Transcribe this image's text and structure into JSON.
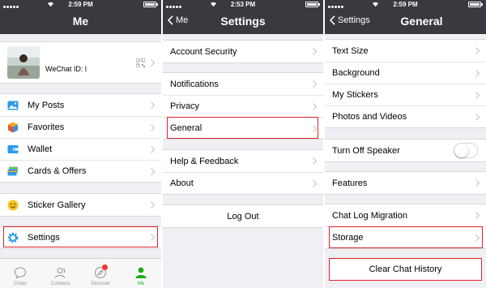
{
  "screens": [
    {
      "status_time": "2:59 PM",
      "nav_title": "Me",
      "profile": {
        "wechat_id": "WeChat ID: l"
      },
      "groups": [
        [
          {
            "label": "My Posts",
            "icon": "photo-icon"
          },
          {
            "label": "Favorites",
            "icon": "cube-icon"
          },
          {
            "label": "Wallet",
            "icon": "wallet-icon"
          },
          {
            "label": "Cards & Offers",
            "icon": "cards-icon"
          }
        ],
        [
          {
            "label": "Sticker Gallery",
            "icon": "smiley-icon"
          }
        ],
        [
          {
            "label": "Settings",
            "icon": "gear-icon",
            "highlighted": true
          }
        ]
      ],
      "tabbar": [
        {
          "label": "Chats",
          "icon": "chat-bubble-icon"
        },
        {
          "label": "Contacts",
          "icon": "contacts-icon"
        },
        {
          "label": "Discover",
          "icon": "compass-icon",
          "badge": true
        },
        {
          "label": "Me",
          "icon": "person-icon",
          "active": true
        }
      ]
    },
    {
      "status_time": "2:53 PM",
      "nav_title": "Settings",
      "back_label": "Me",
      "groups": [
        [
          {
            "label": "Account Security"
          }
        ],
        [
          {
            "label": "Notifications"
          },
          {
            "label": "Privacy"
          },
          {
            "label": "General",
            "highlighted": true
          }
        ],
        [
          {
            "label": "Help & Feedback"
          },
          {
            "label": "About"
          }
        ]
      ],
      "logout_label": "Log Out"
    },
    {
      "status_time": "2:59 PM",
      "nav_title": "General",
      "back_label": "Settings",
      "groups": [
        [
          {
            "label": "Text Size"
          },
          {
            "label": "Background"
          },
          {
            "label": "My Stickers"
          },
          {
            "label": "Photos and Videos"
          }
        ],
        [
          {
            "label": "Turn Off Speaker",
            "toggle": false
          }
        ],
        [
          {
            "label": "Features"
          }
        ],
        [
          {
            "label": "Chat Log Migration"
          },
          {
            "label": "Storage",
            "highlighted": true
          }
        ]
      ],
      "clear_label": "Clear Chat History"
    }
  ],
  "colors": {
    "nav_bg": "#393a3f",
    "bg": "#efeff4",
    "highlight": "#d9262b",
    "active_tab": "#1aad19"
  }
}
